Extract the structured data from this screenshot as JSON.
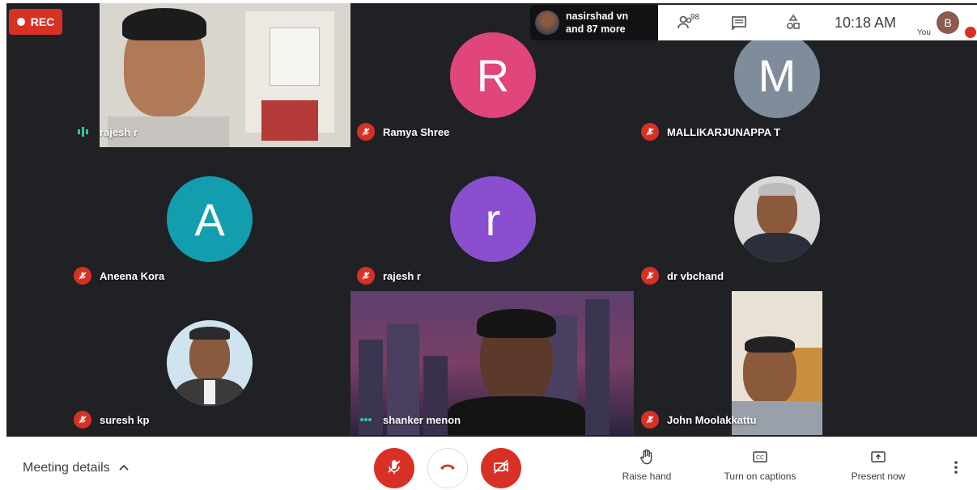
{
  "recording": {
    "label": "REC"
  },
  "participants_pill": {
    "line1": "nasirshad vn",
    "line2": "and 87 more"
  },
  "top_panel": {
    "participant_count": "98",
    "time": "10:18 AM",
    "you_label": "You",
    "self_initial": "B"
  },
  "tiles": [
    {
      "name": "rajesh r",
      "type": "video",
      "speaking": true
    },
    {
      "name": "Ramya Shree",
      "type": "initial",
      "initial": "R",
      "color": "#e0457b",
      "muted": true
    },
    {
      "name": "MALLIKARJUNAPPA T",
      "type": "initial",
      "initial": "M",
      "color": "#7f8c99",
      "muted": true
    },
    {
      "name": "Aneena Kora",
      "type": "initial",
      "initial": "A",
      "color": "#129eaf",
      "muted": true
    },
    {
      "name": "rajesh r",
      "type": "initial",
      "initial": "r",
      "color": "#8a4fcf",
      "muted": true
    },
    {
      "name": "dr vbchand",
      "type": "photo",
      "muted": true
    },
    {
      "name": "suresh kp",
      "type": "photo",
      "muted": true
    },
    {
      "name": "shanker menon",
      "type": "video",
      "speaking": true
    },
    {
      "name": "John Moolakkattu",
      "type": "video",
      "muted": true
    }
  ],
  "bottom_bar": {
    "meeting_details": "Meeting details",
    "raise_hand": "Raise hand",
    "captions": "Turn on captions",
    "present": "Present now"
  },
  "colors": {
    "stage": "#202124",
    "danger": "#d93025"
  }
}
